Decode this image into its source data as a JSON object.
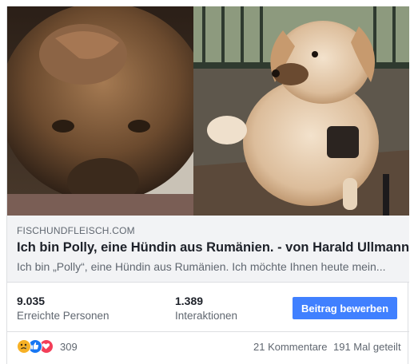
{
  "link_preview": {
    "domain": "FISCHUNDFLEISCH.COM",
    "title": "Ich bin Polly, eine Hündin aus Rumänien. - von Harald Ullmann",
    "description": "Ich bin „Polly“, eine Hündin aus Rumänien. Ich möchte Ihnen heute mein..."
  },
  "stats": {
    "reach_value": "9.035",
    "reach_label": "Erreichte Personen",
    "engagement_value": "1.389",
    "engagement_label": "Interaktionen",
    "boost_label": "Beitrag bewerben"
  },
  "footer": {
    "reaction_icons": [
      "sad-reaction-icon",
      "like-reaction-icon",
      "love-reaction-icon"
    ],
    "reaction_count": "309",
    "comments": "21 Kommentare",
    "shares": "191 Mal geteilt"
  },
  "colors": {
    "boost_button": "#4080ff",
    "like": "#1877f2",
    "love": "#f33e58",
    "sad": "#f7b125"
  }
}
